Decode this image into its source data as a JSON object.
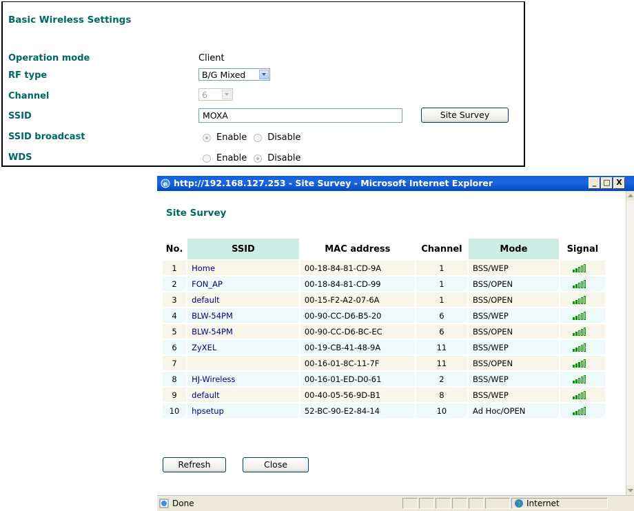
{
  "settings": {
    "title": "Basic Wireless Settings",
    "operation_mode": {
      "label": "Operation mode",
      "value": "Client"
    },
    "rf_type": {
      "label": "RF type",
      "value": "B/G Mixed"
    },
    "channel": {
      "label": "Channel",
      "value": "6"
    },
    "ssid": {
      "label": "SSID",
      "value": "MOXA",
      "button": "Site Survey"
    },
    "ssid_broadcast": {
      "label": "SSID broadcast",
      "options": [
        "Enable",
        "Disable"
      ],
      "selected": "Enable"
    },
    "wds": {
      "label": "WDS",
      "options": [
        "Enable",
        "Disable"
      ],
      "selected": "Disable"
    }
  },
  "window": {
    "title": "http://192.168.127.253 - Site Survey - Microsoft Internet Explorer",
    "controls": [
      "_",
      "□",
      "X"
    ],
    "status": "Done",
    "zone": "Internet"
  },
  "survey": {
    "title": "Site Survey",
    "columns": [
      "No.",
      "SSID",
      "MAC address",
      "Channel",
      "Mode",
      "Signal"
    ],
    "rows": [
      {
        "no": "1",
        "ssid": "Home",
        "mac": "00-18-84-81-CD-9A",
        "channel": "1",
        "mode": "BSS/WEP",
        "signal": 2
      },
      {
        "no": "2",
        "ssid": "FON_AP",
        "mac": "00-18-84-81-CD-99",
        "channel": "1",
        "mode": "BSS/OPEN",
        "signal": 2
      },
      {
        "no": "3",
        "ssid": "default",
        "mac": "00-15-F2-A2-07-6A",
        "channel": "1",
        "mode": "BSS/OPEN",
        "signal": 2
      },
      {
        "no": "4",
        "ssid": "BLW-54PM",
        "mac": "00-90-CC-D6-B5-20",
        "channel": "6",
        "mode": "BSS/WEP",
        "signal": 2
      },
      {
        "no": "5",
        "ssid": "BLW-54PM",
        "mac": "00-90-CC-D6-BC-EC",
        "channel": "6",
        "mode": "BSS/OPEN",
        "signal": 2
      },
      {
        "no": "6",
        "ssid": "ZyXEL",
        "mac": "00-19-CB-41-48-9A",
        "channel": "11",
        "mode": "BSS/WEP",
        "signal": 2
      },
      {
        "no": "7",
        "ssid": "",
        "mac": "00-16-01-8C-11-7F",
        "channel": "11",
        "mode": "BSS/OPEN",
        "signal": 3
      },
      {
        "no": "8",
        "ssid": "HJ-Wireless",
        "mac": "00-16-01-ED-D0-61",
        "channel": "2",
        "mode": "BSS/WEP",
        "signal": 2
      },
      {
        "no": "9",
        "ssid": "default",
        "mac": "00-40-05-56-9D-B1",
        "channel": "8",
        "mode": "BSS/WEP",
        "signal": 2
      },
      {
        "no": "10",
        "ssid": "hpsetup",
        "mac": "52-BC-90-E2-84-14",
        "channel": "10",
        "mode": "Ad Hoc/OPEN",
        "signal": 2
      }
    ],
    "signal_max": 5,
    "buttons": {
      "refresh": "Refresh",
      "close": "Close"
    }
  },
  "colors": {
    "label_teal": "#006666",
    "header_teal": "#ccece4",
    "signal_green": "#009900",
    "ssid_link": "#000080"
  }
}
